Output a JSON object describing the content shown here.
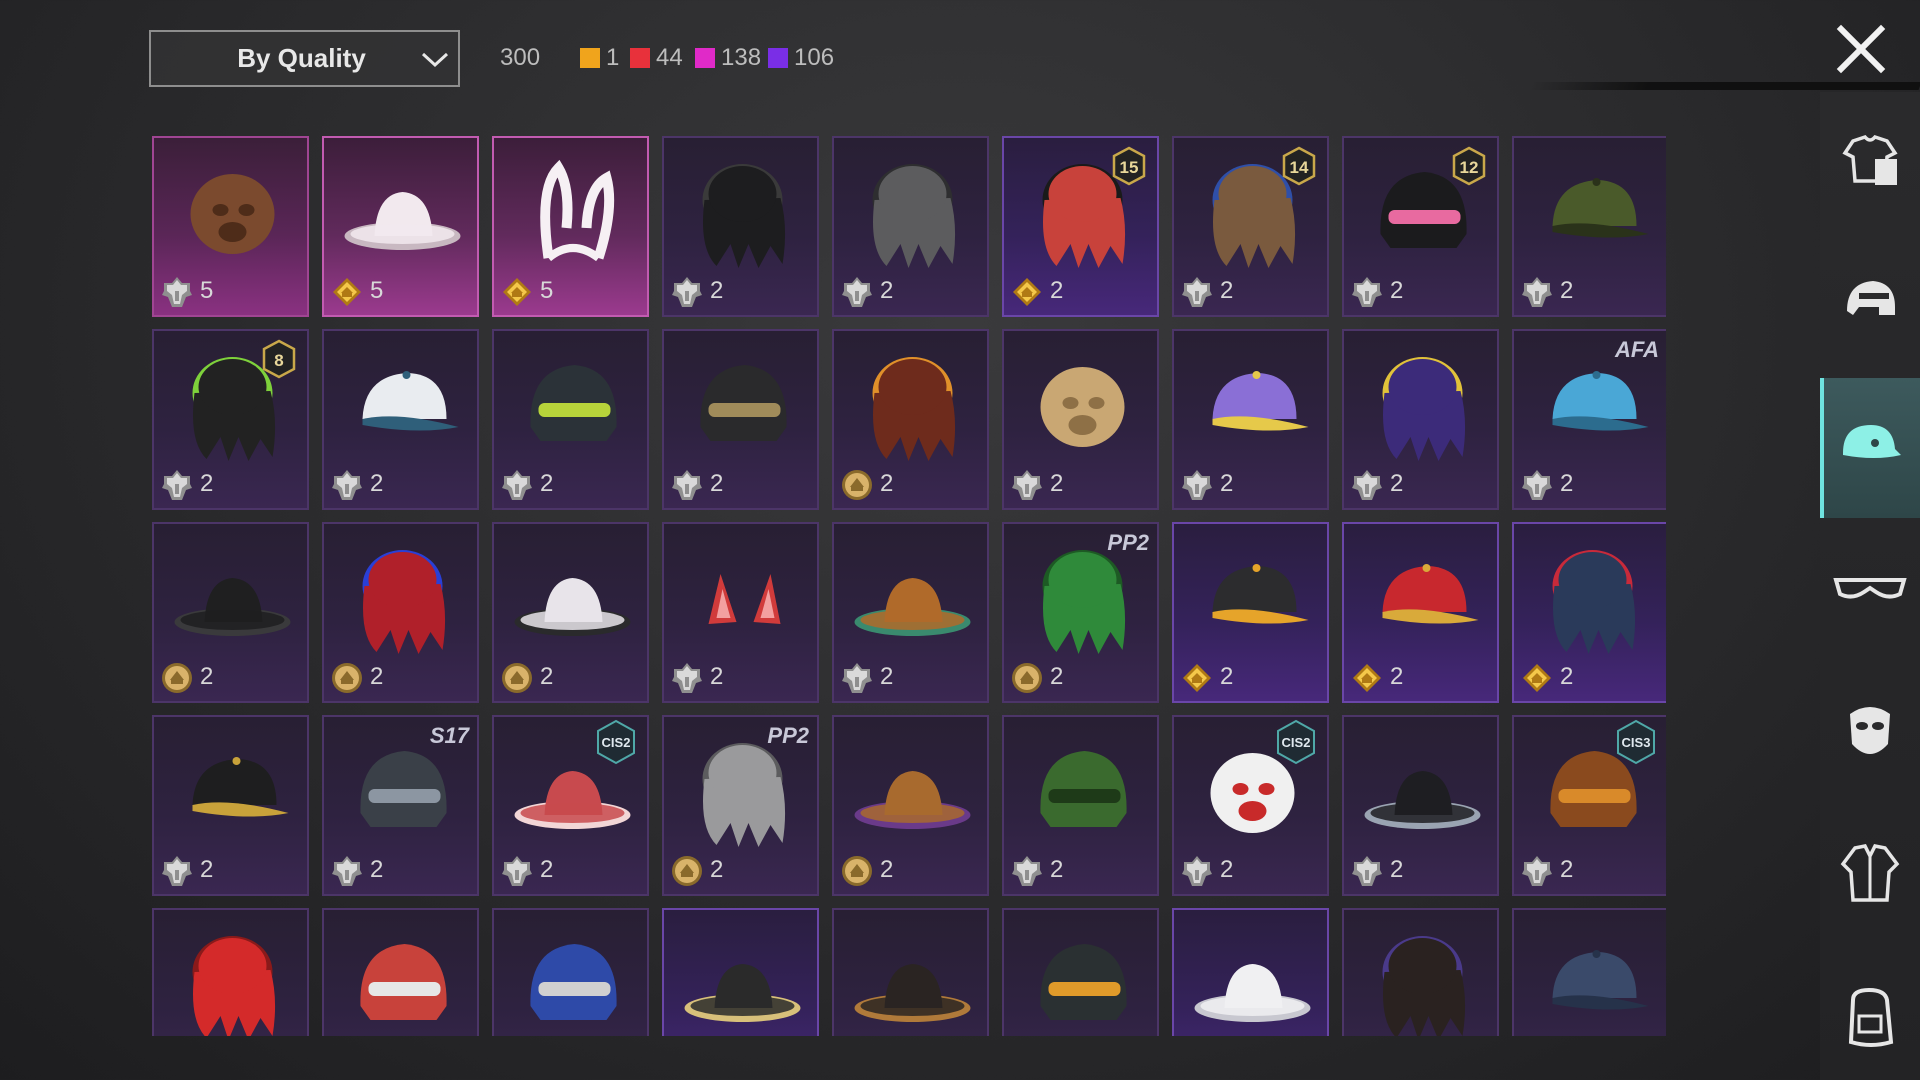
{
  "toolbar": {
    "sort_label": "By Quality",
    "total": "300",
    "quality_counts": [
      {
        "color": "#f0a41c",
        "count": "1"
      },
      {
        "color": "#e8313b",
        "count": "44"
      },
      {
        "color": "#e02ac8",
        "count": "138"
      },
      {
        "color": "#7a2ee6",
        "count": "106"
      }
    ]
  },
  "sidebar": {
    "categories": [
      {
        "name": "outfit-icon",
        "active": false
      },
      {
        "name": "helmet-icon",
        "active": false
      },
      {
        "name": "hat-icon",
        "active": true
      },
      {
        "name": "glasses-icon",
        "active": false
      },
      {
        "name": "mask-icon",
        "active": false
      },
      {
        "name": "jacket-icon",
        "active": false
      },
      {
        "name": "backpack-icon",
        "active": false
      }
    ]
  },
  "items": [
    {
      "art": "bear-head",
      "coin": "silver",
      "count": "5",
      "quality": "pink"
    },
    {
      "art": "white-sunhat",
      "coin": "gold",
      "count": "5",
      "quality": "pinklight"
    },
    {
      "art": "bunny-ears",
      "coin": "gold",
      "count": "5",
      "quality": "pinklight"
    },
    {
      "art": "black-hair",
      "coin": "silver",
      "count": "2",
      "quality": "violet"
    },
    {
      "art": "grey-hair",
      "coin": "silver",
      "count": "2",
      "quality": "violet"
    },
    {
      "art": "pumpkin-hair",
      "coin": "gold",
      "count": "2",
      "quality": "purple",
      "badge": "15"
    },
    {
      "art": "cat-cap-hair",
      "coin": "silver",
      "count": "2",
      "quality": "violet",
      "badge": "14"
    },
    {
      "art": "bunny-helmet",
      "coin": "silver",
      "count": "2",
      "quality": "violet",
      "badge": "12"
    },
    {
      "art": "officer-cap",
      "coin": "silver",
      "count": "2",
      "quality": "violet"
    },
    {
      "art": "skull-hood",
      "coin": "silver",
      "count": "2",
      "quality": "violet",
      "badge": "8"
    },
    {
      "art": "white-cap",
      "coin": "silver",
      "count": "2",
      "quality": "violet"
    },
    {
      "art": "gas-helmet",
      "coin": "silver",
      "count": "2",
      "quality": "violet"
    },
    {
      "art": "black-helmet",
      "coin": "silver",
      "count": "2",
      "quality": "violet"
    },
    {
      "art": "goggles-hair",
      "coin": "bronze",
      "count": "2",
      "quality": "violet"
    },
    {
      "art": "bunny-safari",
      "coin": "silver",
      "count": "2",
      "quality": "violet"
    },
    {
      "art": "rainbow-cap",
      "coin": "silver",
      "count": "2",
      "quality": "violet"
    },
    {
      "art": "purple-hair-helmet",
      "coin": "silver",
      "count": "2",
      "quality": "violet"
    },
    {
      "art": "blue-cap",
      "coin": "silver",
      "count": "2",
      "quality": "violet",
      "text_badge": "AFA"
    },
    {
      "art": "black-beanie",
      "coin": "bronze",
      "count": "2",
      "quality": "violet"
    },
    {
      "art": "red-bow-hair",
      "coin": "bronze",
      "count": "2",
      "quality": "violet"
    },
    {
      "art": "wide-white-hat",
      "coin": "bronze",
      "count": "2",
      "quality": "violet"
    },
    {
      "art": "red-ears",
      "coin": "silver",
      "count": "2",
      "quality": "violet"
    },
    {
      "art": "orange-dread-hat",
      "coin": "silver",
      "count": "2",
      "quality": "violet"
    },
    {
      "art": "green-hair",
      "coin": "bronze",
      "count": "2",
      "quality": "violet",
      "text_badge": "PP2"
    },
    {
      "art": "mesh-cap",
      "coin": "gold",
      "count": "2",
      "quality": "purple"
    },
    {
      "art": "red-gold-cap",
      "coin": "gold",
      "count": "2",
      "quality": "purple"
    },
    {
      "art": "bucket-hat-red-hair",
      "coin": "gold",
      "count": "2",
      "quality": "purple"
    },
    {
      "art": "black-gold-cap",
      "coin": "silver",
      "count": "2",
      "quality": "violet"
    },
    {
      "art": "horned-helmet",
      "coin": "silver",
      "count": "2",
      "quality": "violet",
      "text_badge": "S17"
    },
    {
      "art": "red-beanie",
      "coin": "silver",
      "count": "2",
      "quality": "violet",
      "cis": "CIS2"
    },
    {
      "art": "silver-hair",
      "coin": "bronze",
      "count": "2",
      "quality": "violet",
      "text_badge": "PP2"
    },
    {
      "art": "braid-hat",
      "coin": "bronze",
      "count": "2",
      "quality": "violet"
    },
    {
      "art": "green-net-helmet",
      "coin": "silver",
      "count": "2",
      "quality": "violet"
    },
    {
      "art": "chef-mask",
      "coin": "silver",
      "count": "2",
      "quality": "violet",
      "cis": "CIS2"
    },
    {
      "art": "witch-hat",
      "coin": "silver",
      "count": "2",
      "quality": "violet"
    },
    {
      "art": "barrel-helmet",
      "coin": "silver",
      "count": "2",
      "quality": "violet",
      "cis": "CIS3"
    },
    {
      "art": "red-mohawk",
      "quality": "violet"
    },
    {
      "art": "football-helmet",
      "quality": "violet"
    },
    {
      "art": "cricket-helmet",
      "quality": "violet"
    },
    {
      "art": "sombrero",
      "quality": "purple"
    },
    {
      "art": "steampunk-hat",
      "quality": "violet"
    },
    {
      "art": "cyber-helmet",
      "quality": "violet"
    },
    {
      "art": "white-bowl-hat",
      "quality": "purple"
    },
    {
      "art": "dark-hair",
      "quality": "violet"
    },
    {
      "art": "navy-cap",
      "quality": "violet"
    }
  ]
}
